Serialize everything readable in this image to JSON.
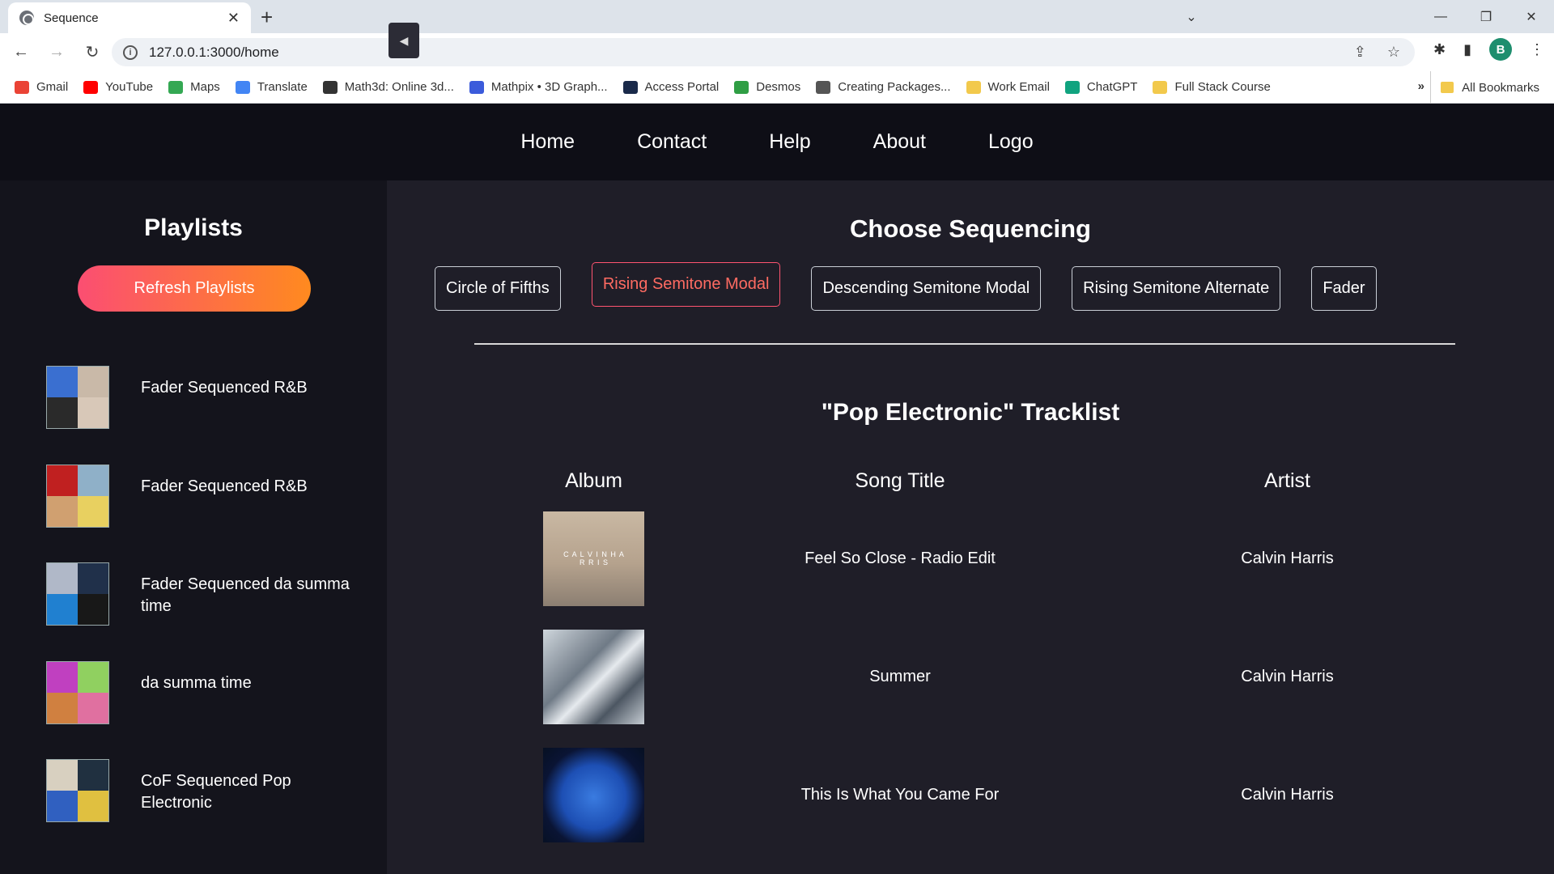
{
  "browser": {
    "tab_title": "Sequence",
    "url": "127.0.0.1:3000/home",
    "avatar_letter": "B",
    "bookmarks": [
      {
        "label": "Gmail",
        "color": "#ea4335"
      },
      {
        "label": "YouTube",
        "color": "#ff0000"
      },
      {
        "label": "Maps",
        "color": "#34a853"
      },
      {
        "label": "Translate",
        "color": "#4285f4"
      },
      {
        "label": "Math3d: Online 3d...",
        "color": "#333333"
      },
      {
        "label": "Mathpix • 3D Graph...",
        "color": "#3b5bdb"
      },
      {
        "label": "Access Portal",
        "color": "#1a2a4a"
      },
      {
        "label": "Desmos",
        "color": "#2f9e44"
      },
      {
        "label": "Creating Packages...",
        "color": "#555555"
      },
      {
        "label": "Work Email",
        "color": "#f2c94c"
      },
      {
        "label": "ChatGPT",
        "color": "#10a37f"
      },
      {
        "label": "Full Stack Course",
        "color": "#f2c94c"
      }
    ],
    "all_bookmarks_label": "All Bookmarks",
    "more_label": "»"
  },
  "nav": {
    "items": [
      "Home",
      "Contact",
      "Help",
      "About",
      "Logo"
    ]
  },
  "sidebar": {
    "title": "Playlists",
    "refresh_label": "Refresh Playlists",
    "collapse_label": "◀",
    "playlists": [
      {
        "name": "Fader Sequenced R&B",
        "colors": [
          "#3a6fd0",
          "#c9b9a8",
          "#2a2a2a",
          "#d8c8b8"
        ]
      },
      {
        "name": "Fader Sequenced R&B",
        "colors": [
          "#c02020",
          "#8fb0c8",
          "#d0a070",
          "#e8d060"
        ]
      },
      {
        "name": "Fader Sequenced da summa time",
        "colors": [
          "#b0b8c8",
          "#20304a",
          "#2080d0",
          "#181818"
        ]
      },
      {
        "name": "da summa time",
        "colors": [
          "#c040c0",
          "#90d060",
          "#d08040",
          "#e070a0"
        ]
      },
      {
        "name": "CoF Sequenced Pop Electronic",
        "colors": [
          "#d8d0c0",
          "#203040",
          "#3060c0",
          "#e0c040"
        ]
      }
    ]
  },
  "main": {
    "title": "Choose Sequencing",
    "sequencing_options": [
      {
        "label": "Circle of Fifths",
        "active": false
      },
      {
        "label": "Rising Semitone Modal",
        "active": true
      },
      {
        "label": "Descending Semitone Modal",
        "active": false
      },
      {
        "label": "Rising Semitone Alternate",
        "active": false
      },
      {
        "label": "Fader",
        "active": false
      }
    ],
    "tracklist_title": "\"Pop Electronic\" Tracklist",
    "columns": [
      "Album",
      "Song Title",
      "Artist"
    ],
    "tracks": [
      {
        "song": "Feel So Close - Radio Edit",
        "artist": "Calvin Harris"
      },
      {
        "song": "Summer",
        "artist": "Calvin Harris"
      },
      {
        "song": "This Is What You Came For",
        "artist": "Calvin Harris"
      }
    ]
  }
}
